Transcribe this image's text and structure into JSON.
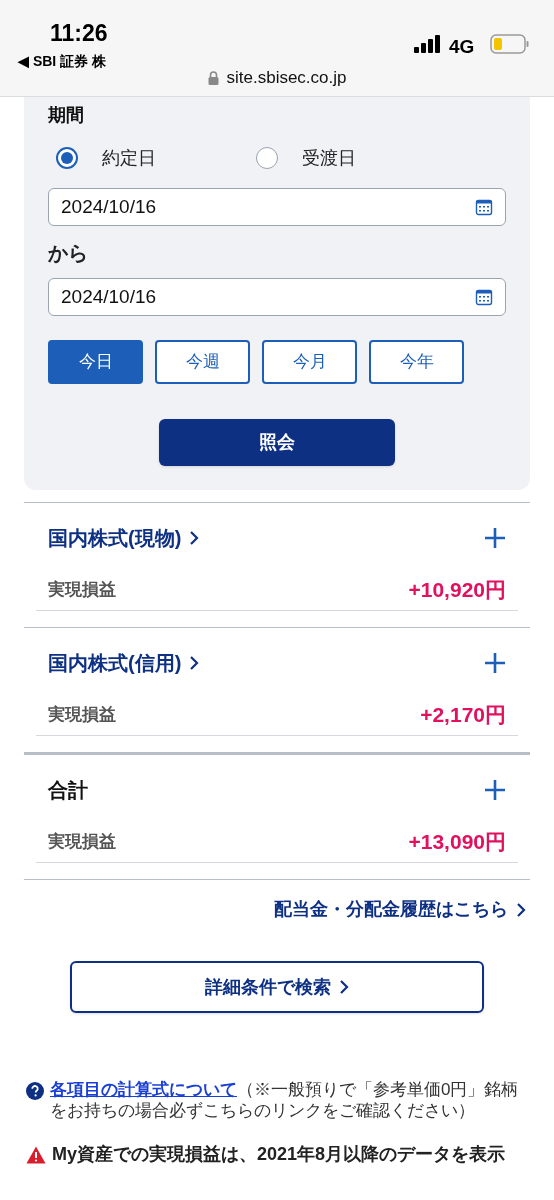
{
  "status_bar": {
    "time": "11:26",
    "back_app": "◀ SBI 証券 株",
    "network": "4G",
    "url": "site.sbisec.co.jp"
  },
  "period": {
    "label": "期間",
    "radios": [
      {
        "label": "約定日",
        "selected": true
      },
      {
        "label": "受渡日",
        "selected": false
      }
    ],
    "date_from": "2024/10/16",
    "from_label": "から",
    "date_to": "2024/10/16",
    "quick_buttons": [
      {
        "label": "今日",
        "selected": true
      },
      {
        "label": "今週",
        "selected": false
      },
      {
        "label": "今月",
        "selected": false
      },
      {
        "label": "今年",
        "selected": false
      }
    ],
    "submit": "照会"
  },
  "sections": [
    {
      "title": "国内株式(現物)",
      "link": true,
      "row_label": "実現損益",
      "value": "+10,920円"
    },
    {
      "title": "国内株式(信用)",
      "link": true,
      "row_label": "実現損益",
      "value": "+2,170円"
    },
    {
      "title": "合計",
      "link": false,
      "row_label": "実現損益",
      "value": "+13,090円"
    }
  ],
  "dividend_link": "配当金・分配金履歴はこちら",
  "search_button": "詳細条件で検索",
  "notes": [
    {
      "kind": "help",
      "link": "各項目の計算式について",
      "text": "（※一般預りで「参考単価0円」銘柄をお持ちの場合必ずこちらのリンクをご確認ください）"
    },
    {
      "kind": "warning",
      "text": "My資産での実現損益は、2021年8月以降のデータを表示"
    }
  ]
}
